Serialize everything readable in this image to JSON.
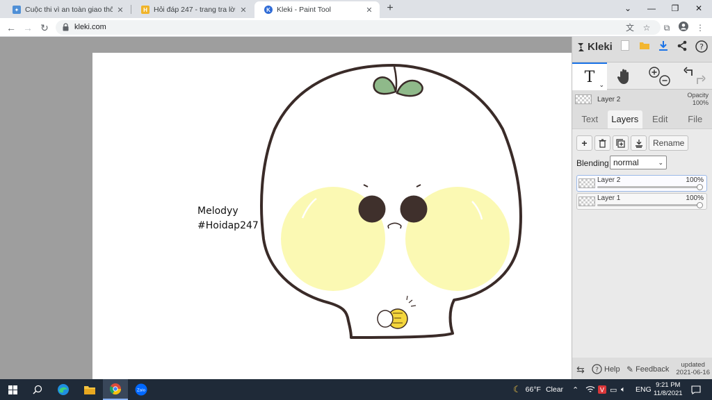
{
  "browser": {
    "tabs": [
      {
        "title": "Cuộc thi vì an toàn giao thông th",
        "active": false
      },
      {
        "title": "Hỏi đáp 247 - trang tra lời",
        "active": false
      },
      {
        "title": "Kleki - Paint Tool",
        "active": true
      }
    ],
    "url": "kleki.com",
    "window_controls": [
      "⌄",
      "—",
      "❐",
      "✕"
    ]
  },
  "app": {
    "name": "Kleki",
    "current_layer": {
      "name": "Layer 2",
      "opacity_label": "Opacity",
      "opacity": "100%"
    },
    "panel_tabs": [
      "Text",
      "Layers",
      "Edit",
      "File"
    ],
    "active_tab": "Layers",
    "rename_label": "Rename",
    "blending_label": "Blending",
    "blending_value": "normal",
    "layers": [
      {
        "name": "Layer 2",
        "opacity": "100%",
        "level": 1.0
      },
      {
        "name": "Layer 1",
        "opacity": "100%",
        "level": 1.0
      }
    ],
    "bottom": {
      "help": "Help",
      "feedback": "Feedback",
      "updated_label": "updated",
      "updated_date": "2021-06-16"
    }
  },
  "canvas": {
    "text_lines": [
      "Melodyy",
      "#Hoidap247"
    ],
    "colors": {
      "outline": "#3a2b28",
      "cheek": "#fbf9b3",
      "leaf": "#8fb98a",
      "eye": "#3f302c",
      "coin": "#f4d63c"
    }
  },
  "taskbar": {
    "weather_temp": "66°F",
    "weather_desc": "Clear",
    "lang": "ENG",
    "time": "9:21 PM",
    "date": "11/8/2021"
  }
}
